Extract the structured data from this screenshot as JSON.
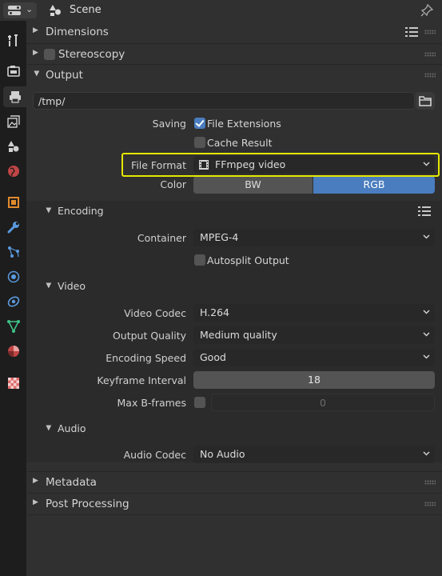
{
  "header": {
    "title": "Scene",
    "editor_icon": "properties-editor-icon",
    "scene_icon": "scene-icon",
    "pin_icon": "pin-icon"
  },
  "sidebar": {
    "tabs": [
      {
        "name": "tool-tab",
        "icon": "wrench-screwdriver-icon"
      },
      {
        "name": "render-tab",
        "icon": "camera-back-icon"
      },
      {
        "name": "output-tab",
        "icon": "printer-icon",
        "active": true
      },
      {
        "name": "view-layer-tab",
        "icon": "images-icon"
      },
      {
        "name": "scene-tab",
        "icon": "scene-cone-sphere-icon"
      },
      {
        "name": "world-tab",
        "icon": "world-globe-icon"
      },
      {
        "name": "object-tab",
        "icon": "object-square-icon"
      },
      {
        "name": "modifiers-tab",
        "icon": "wrench-icon"
      },
      {
        "name": "particles-tab",
        "icon": "particles-icon"
      },
      {
        "name": "physics-tab",
        "icon": "physics-orbit-icon"
      },
      {
        "name": "constraints-tab",
        "icon": "constraint-icon"
      },
      {
        "name": "data-tab",
        "icon": "mesh-data-triangle-icon"
      },
      {
        "name": "material-tab",
        "icon": "material-sphere-icon"
      },
      {
        "name": "texture-tab",
        "icon": "checker-texture-icon"
      }
    ]
  },
  "panels": {
    "dimensions": "Dimensions",
    "stereoscopy": "Stereoscopy",
    "output": "Output",
    "metadata": "Metadata",
    "post_processing": "Post Processing"
  },
  "output": {
    "path": "/tmp/",
    "saving_label": "Saving",
    "file_extensions_label": "File Extensions",
    "file_extensions_checked": true,
    "cache_result_label": "Cache Result",
    "cache_result_checked": false,
    "file_format_label": "File Format",
    "file_format_value": "FFmpeg video",
    "color_label": "Color",
    "color_options": [
      "BW",
      "RGB"
    ],
    "color_selected": "RGB"
  },
  "encoding": {
    "title": "Encoding",
    "container_label": "Container",
    "container_value": "MPEG-4",
    "autosplit_label": "Autosplit Output",
    "autosplit_checked": false
  },
  "video": {
    "title": "Video",
    "codec_label": "Video Codec",
    "codec_value": "H.264",
    "quality_label": "Output Quality",
    "quality_value": "Medium quality",
    "speed_label": "Encoding Speed",
    "speed_value": "Good",
    "keyframe_label": "Keyframe Interval",
    "keyframe_value": "18",
    "bframes_label": "Max B-frames",
    "bframes_checked": false,
    "bframes_value": "0"
  },
  "audio": {
    "title": "Audio",
    "codec_label": "Audio Codec",
    "codec_value": "No Audio"
  },
  "colors": {
    "accent": "#4a7dbf",
    "highlight": "#e5e800",
    "background": "#303030",
    "sidebar": "#1d1d1d"
  }
}
